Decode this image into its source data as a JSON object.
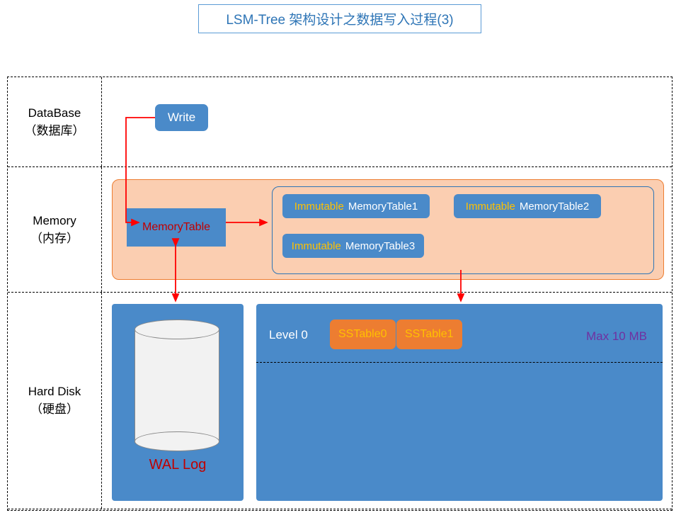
{
  "title": "LSM-Tree 架构设计之数据写入过程(3)",
  "rows": {
    "database": {
      "label": "DataBase\n（数据库）",
      "write": "Write"
    },
    "memory": {
      "label": "Memory\n（内存）",
      "memoryTable": "MemoryTable",
      "immutableKeyword": "Immutable",
      "imm1": "MemoryTable1",
      "imm2": "MemoryTable2",
      "imm3": "MemoryTable3"
    },
    "hardDisk": {
      "label": "Hard Disk\n（硬盘）",
      "walLog": "WAL Log",
      "level0": "Level 0",
      "sst0": "SSTable0",
      "sst1": "SSTable1",
      "max": "Max 10 MB"
    }
  }
}
